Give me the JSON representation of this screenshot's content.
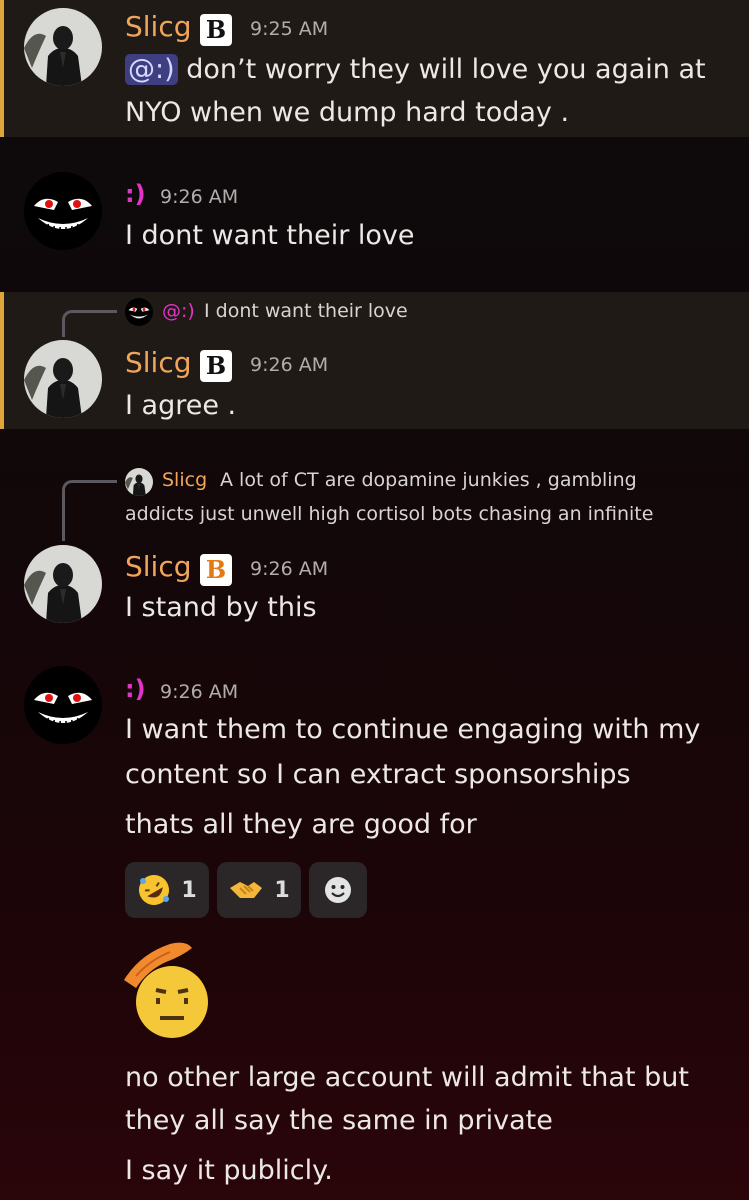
{
  "messages": {
    "m1": {
      "author": "Slicg",
      "badge": "B",
      "time": "9:25 AM",
      "mention": "@:)",
      "line1": " don’t worry they will love you again at",
      "line2": "NYO when we dump hard today ."
    },
    "m2": {
      "author": ":)",
      "time": "9:26 AM",
      "text": "I dont want their love"
    },
    "m3": {
      "reply_mention": "@:)",
      "reply_text": "I dont want their love",
      "author": "Slicg",
      "badge": "B",
      "time": "9:26 AM",
      "text": "I agree ."
    },
    "m4": {
      "reply_author": "Slicg",
      "reply_line1": "A lot of CT are dopamine junkies , gambling",
      "reply_line2": "addicts just unwell high cortisol bots chasing an infinite",
      "author": "Slicg",
      "badge": "B",
      "time": "9:26 AM",
      "text": "I stand by this"
    },
    "m5": {
      "author": ":)",
      "time": "9:26 AM",
      "line1": "I want them to continue engaging with my",
      "line2": "content so I can extract sponsorships",
      "line3": "thats all they are good for",
      "reactions": [
        {
          "icon": "rolling-on-floor-laughing-icon",
          "count": "1"
        },
        {
          "icon": "handshake-icon",
          "count": "1"
        },
        {
          "icon": "add-reaction-icon",
          "count": ""
        }
      ]
    },
    "m6": {
      "emoji": "saluting-face-icon",
      "line1": "no other large account will admit that but",
      "line2": "they all say the same in private",
      "line3": "I say it publicly."
    }
  },
  "colors": {
    "highlight_bar": "#e0a63a",
    "highlight_bg": "#201a16",
    "author_orange": "#f0a55a",
    "author_pink": "#e234c6",
    "mention_bg": "#3d3f80"
  }
}
